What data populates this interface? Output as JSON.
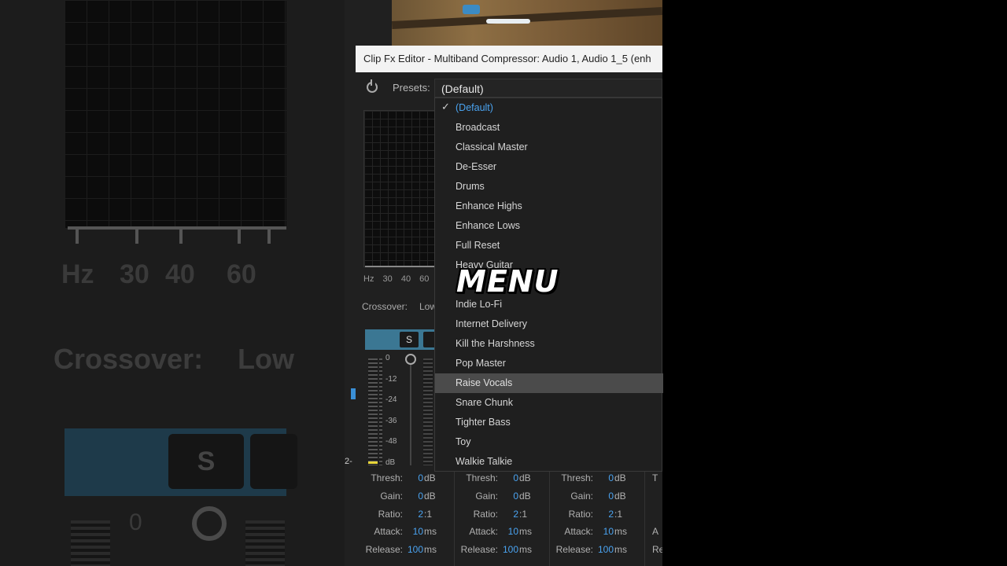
{
  "window": {
    "title": "Clip Fx Editor - Multiband Compressor: Audio 1, Audio 1_5 (enh"
  },
  "presets": {
    "label": "Presets:",
    "value": "(Default)"
  },
  "menu": {
    "items": [
      {
        "label": "(Default)",
        "state": "selected"
      },
      {
        "label": "Broadcast"
      },
      {
        "label": "Classical Master"
      },
      {
        "label": "De-Esser"
      },
      {
        "label": "Drums"
      },
      {
        "label": "Enhance Highs"
      },
      {
        "label": "Enhance Lows"
      },
      {
        "label": "Full Reset"
      },
      {
        "label": "Heavy Guitar"
      },
      {
        "label": "Indie Lo-Fi"
      },
      {
        "label": "Internet Delivery"
      },
      {
        "label": "Kill the Harshness"
      },
      {
        "label": "Pop Master"
      },
      {
        "label": "Raise Vocals",
        "state": "highlighted"
      },
      {
        "label": "Snare Chunk"
      },
      {
        "label": "Tighter Bass"
      },
      {
        "label": "Toy"
      },
      {
        "label": "Walkie Talkie"
      }
    ]
  },
  "overlay": {
    "word": "MENU"
  },
  "graph": {
    "freq_labels": [
      "Hz",
      "30",
      "40",
      "60"
    ]
  },
  "crossover": {
    "label": "Crossover:",
    "value": "Low"
  },
  "band": {
    "solo_label": "S",
    "db_scale": [
      "0",
      "-12",
      "-24",
      "-36",
      "-48",
      "dB"
    ]
  },
  "edge_text": "2-",
  "params": {
    "columns": [
      {
        "thresh": {
          "label": "Thresh:",
          "value": "0",
          "unit": "dB"
        },
        "gain": {
          "label": "Gain:",
          "value": "0",
          "unit": "dB"
        },
        "ratio": {
          "label": "Ratio:",
          "value": "2",
          "unit": ":1"
        },
        "attack": {
          "label": "Attack:",
          "value": "10",
          "unit": "ms"
        },
        "release": {
          "label": "Release:",
          "value": "100",
          "unit": "ms"
        }
      },
      {
        "thresh": {
          "label": "Thresh:",
          "value": "0",
          "unit": "dB"
        },
        "gain": {
          "label": "Gain:",
          "value": "0",
          "unit": "dB"
        },
        "ratio": {
          "label": "Ratio:",
          "value": "2",
          "unit": ":1"
        },
        "attack": {
          "label": "Attack:",
          "value": "10",
          "unit": "ms"
        },
        "release": {
          "label": "Release:",
          "value": "100",
          "unit": "ms"
        }
      },
      {
        "thresh": {
          "label": "Thresh:",
          "value": "0",
          "unit": "dB"
        },
        "gain": {
          "label": "Gain:",
          "value": "0",
          "unit": "dB"
        },
        "ratio": {
          "label": "Ratio:",
          "value": "2",
          "unit": ":1"
        },
        "attack": {
          "label": "Attack:",
          "value": "10",
          "unit": "ms"
        },
        "release": {
          "label": "Release:",
          "value": "100",
          "unit": "ms"
        }
      }
    ],
    "partial_labels": [
      "T",
      "",
      "",
      "A",
      "Re"
    ]
  },
  "background": {
    "hz_label": "Hz",
    "freq_labels": [
      "30",
      "40",
      "60"
    ],
    "crossover_label": "Crossover:",
    "crossover_value": "Low",
    "solo_label": "S",
    "zero_label": "0"
  },
  "colors": {
    "accent_blue": "#4aa3f0",
    "band_header": "#3b7793",
    "highlight_row": "#4b4b4b",
    "meter_peak": "#e8d63a"
  }
}
